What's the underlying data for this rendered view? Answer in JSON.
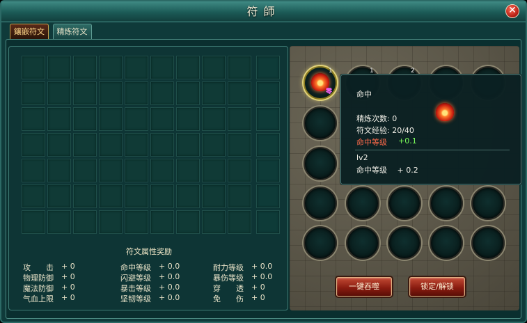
{
  "window": {
    "title": "符師",
    "close_icon": "close-icon"
  },
  "tabs": [
    {
      "label": "鑲嵌符文",
      "active": true
    },
    {
      "label": "精炼符文",
      "active": false
    }
  ],
  "left_panel": {
    "bonus_title": "符文属性奖励",
    "stats": [
      {
        "label": "攻　　击",
        "value": "+ 0"
      },
      {
        "label": "物理防御",
        "value": "+ 0"
      },
      {
        "label": "魔法防御",
        "value": "+ 0"
      },
      {
        "label": "气血上限",
        "value": "+ 0"
      },
      {
        "label": "命中等级",
        "value": "+ 0.0"
      },
      {
        "label": "闪避等级",
        "value": "+ 0.0"
      },
      {
        "label": "暴击等级",
        "value": "+ 0.0"
      },
      {
        "label": "坚韧等级",
        "value": "+ 0.0"
      },
      {
        "label": "耐力等级",
        "value": "+ 0.0"
      },
      {
        "label": "暴伤等级",
        "value": "+ 0.0"
      },
      {
        "label": "穿　　透",
        "value": "+ 0"
      },
      {
        "label": "免　　伤",
        "value": "+ 0"
      }
    ]
  },
  "slots": {
    "numbers": [
      "1",
      "1",
      "2"
    ],
    "gem_mark": "零"
  },
  "buttons": {
    "devour_all": "一键吞噬",
    "lock_unlock": "锁定/解锁"
  },
  "tooltip": {
    "name": "命中",
    "refine_count": "精炼次数: 0",
    "rune_exp": "符文经验: 20/40",
    "attr_label": "命中等级",
    "attr_value": "+0.1",
    "next_level": "lv2",
    "next_attr": "命中等级　 + 0.2"
  },
  "colors": {
    "accent_red": "#ff6a4a",
    "accent_green": "#7cff5a",
    "panel_teal": "#0e3535"
  }
}
